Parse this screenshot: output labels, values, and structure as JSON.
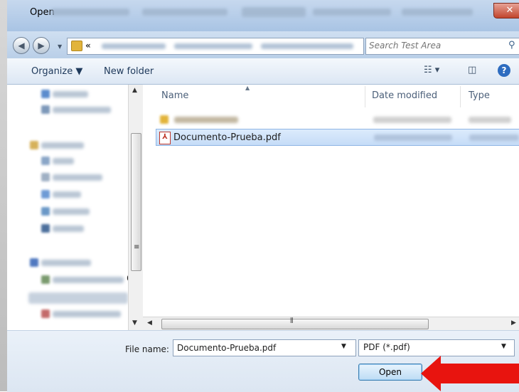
{
  "window": {
    "title": "Open",
    "close_glyph": "✕"
  },
  "address_bar": {
    "chevron": "«",
    "search_placeholder": "Search Test Area"
  },
  "toolbar": {
    "organize_label": "Organize ▼",
    "new_folder_label": "New folder",
    "views_icon": "view-options-icon",
    "preview_icon": "preview-pane-icon",
    "help_label": "?"
  },
  "file_list": {
    "columns": [
      "Name",
      "Date modified",
      "Type"
    ],
    "files": [
      {
        "name": "Documento-Prueba.pdf",
        "icon": "pdf-icon",
        "selected": true
      }
    ]
  },
  "bottom": {
    "file_name_label": "File name:",
    "file_name_value": "Documento-Prueba.pdf",
    "file_type_value": "PDF (*.pdf)",
    "open_label": "Open"
  },
  "overlay": {
    "arrow_color": "#e8140f",
    "arrow_icon": "red-pointer-arrow-icon"
  }
}
